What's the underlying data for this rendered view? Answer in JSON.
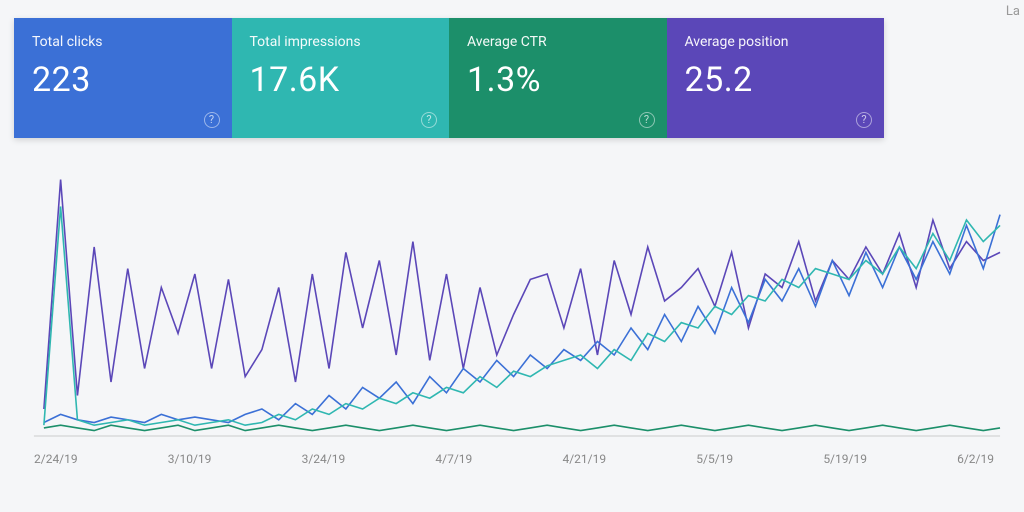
{
  "top_right_fragment": "La",
  "metrics": {
    "clicks": {
      "label": "Total clicks",
      "value": "223",
      "color": "#3b70d6"
    },
    "impressions": {
      "label": "Total impressions",
      "value": "17.6K",
      "color": "#2fb7b1"
    },
    "ctr": {
      "label": "Average CTR",
      "value": "1.3%",
      "color": "#1c8f6a"
    },
    "position": {
      "label": "Average position",
      "value": "25.2",
      "color": "#5b47b8"
    }
  },
  "chart_data": {
    "type": "line",
    "xlabel": "",
    "ylabel": "",
    "x_ticks": [
      "2/24/19",
      "3/10/19",
      "3/24/19",
      "4/7/19",
      "4/21/19",
      "5/5/19",
      "5/19/19",
      "6/2/19"
    ],
    "ylim": [
      0,
      100
    ],
    "series": [
      {
        "name": "Average position",
        "color": "#5b47b8",
        "values": [
          10,
          95,
          15,
          70,
          20,
          62,
          25,
          55,
          38,
          60,
          25,
          58,
          22,
          32,
          55,
          20,
          60,
          25,
          68,
          40,
          65,
          30,
          72,
          28,
          60,
          25,
          55,
          30,
          45,
          58,
          60,
          40,
          62,
          30,
          65,
          45,
          70,
          50,
          55,
          62,
          48,
          68,
          40,
          60,
          55,
          72,
          50,
          65,
          58,
          70,
          60,
          75,
          55,
          80,
          62,
          72,
          65,
          68
        ]
      },
      {
        "name": "Total clicks",
        "color": "#3b70d6",
        "values": [
          5,
          8,
          6,
          5,
          7,
          6,
          5,
          8,
          6,
          7,
          6,
          5,
          8,
          10,
          6,
          12,
          8,
          15,
          10,
          18,
          14,
          20,
          12,
          22,
          16,
          25,
          20,
          28,
          22,
          30,
          25,
          32,
          28,
          35,
          30,
          40,
          32,
          45,
          35,
          48,
          38,
          55,
          42,
          58,
          50,
          62,
          48,
          65,
          52,
          68,
          55,
          70,
          58,
          72,
          60,
          78,
          62,
          82
        ]
      },
      {
        "name": "Total impressions",
        "color": "#2fb7b1",
        "values": [
          4,
          85,
          6,
          4,
          5,
          6,
          4,
          5,
          6,
          4,
          5,
          6,
          4,
          5,
          8,
          6,
          10,
          8,
          12,
          10,
          14,
          12,
          16,
          14,
          18,
          16,
          22,
          18,
          24,
          22,
          26,
          28,
          30,
          25,
          32,
          28,
          38,
          35,
          42,
          40,
          48,
          45,
          52,
          50,
          58,
          55,
          62,
          60,
          58,
          65,
          60,
          70,
          62,
          75,
          65,
          80,
          72,
          78
        ]
      },
      {
        "name": "Average CTR",
        "color": "#1c8f6a",
        "values": [
          3,
          4,
          3,
          2,
          4,
          3,
          2,
          3,
          4,
          2,
          3,
          4,
          2,
          3,
          4,
          3,
          2,
          3,
          4,
          3,
          2,
          3,
          4,
          3,
          2,
          3,
          4,
          3,
          2,
          3,
          4,
          3,
          2,
          3,
          4,
          3,
          2,
          3,
          4,
          3,
          2,
          3,
          4,
          3,
          2,
          3,
          4,
          3,
          2,
          3,
          4,
          3,
          2,
          3,
          4,
          3,
          2,
          3
        ]
      }
    ]
  }
}
